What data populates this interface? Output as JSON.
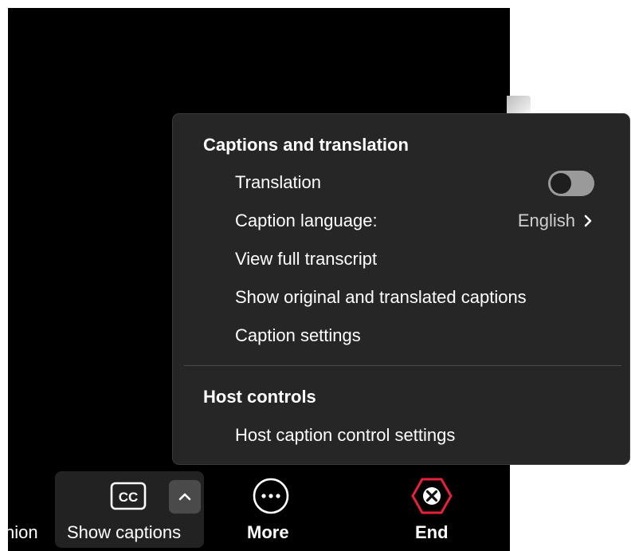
{
  "captions_menu": {
    "section_captions": "Captions and translation",
    "items": {
      "translation": "Translation",
      "caption_language_label": "Caption language:",
      "caption_language_value": "English",
      "view_full_transcript": "View full transcript",
      "show_original_translated": "Show original and translated captions",
      "caption_settings": "Caption settings"
    },
    "translation_toggle_on": false,
    "section_host": "Host controls",
    "host_caption_settings": "Host caption control settings"
  },
  "toolbar": {
    "partial_left_label": "nion",
    "captions_label": "Show captions",
    "cc_icon_text": "CC",
    "more_label": "More",
    "end_label": "End"
  },
  "colors": {
    "menu_background": "#262626",
    "video_background": "#000000",
    "end_accent": "#e8203a",
    "toggle_off": "#9a9a9a"
  },
  "icons": {
    "captions": "cc-icon",
    "captions_expand": "chevron-up-icon",
    "more": "more-dots-icon",
    "end": "end-hexagon-x-icon",
    "caption_language": "chevron-right-icon"
  }
}
